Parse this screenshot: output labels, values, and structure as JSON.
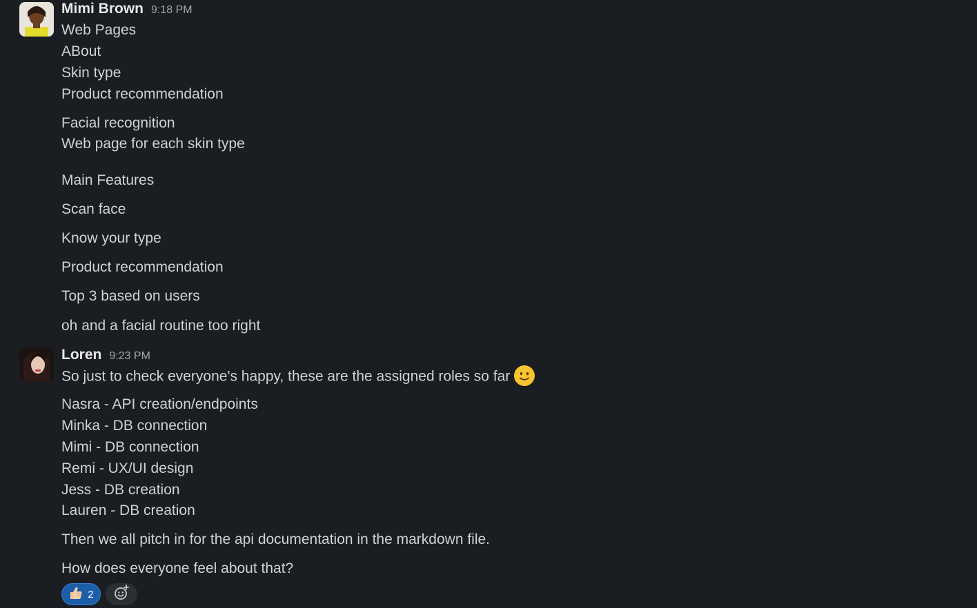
{
  "messages": [
    {
      "author": "Mimi Brown",
      "time": "9:18 PM",
      "avatar_icon": "user-avatar-mimi",
      "lines": [
        "Web Pages",
        "ABout",
        "Skin type",
        "Product recommendation",
        "Facial recognition",
        "Web page for each skin type",
        "Main Features",
        "Scan face",
        "Know your type",
        "Product recommendation",
        "Top 3 based on users",
        "oh and a facial routine too right"
      ]
    },
    {
      "author": "Loren",
      "time": "9:23 PM",
      "avatar_icon": "user-avatar-loren",
      "lines": [
        "So just to check everyone's happy, these are the assigned roles so far",
        "Nasra - API creation/endpoints",
        "Minka - DB connection",
        "Mimi - DB connection",
        "Remi - UX/UI design",
        "Jess - DB creation",
        "Lauren - DB creation",
        "Then we all pitch in for the api documentation in the markdown file.",
        "How does everyone feel about that?"
      ],
      "inline_emoji": "slightly-smiling-face-icon",
      "reactions": [
        {
          "icon": "thumbs-up-icon",
          "count": "2",
          "active": true
        }
      ],
      "add_reaction_icon": "add-reaction-icon"
    }
  ],
  "colors": {
    "background": "#1a1d21",
    "text": "#d1d2d3",
    "author": "#e8e8e8",
    "timestamp": "#a5a6a8",
    "reaction_active_bg": "#1d5ea8"
  }
}
